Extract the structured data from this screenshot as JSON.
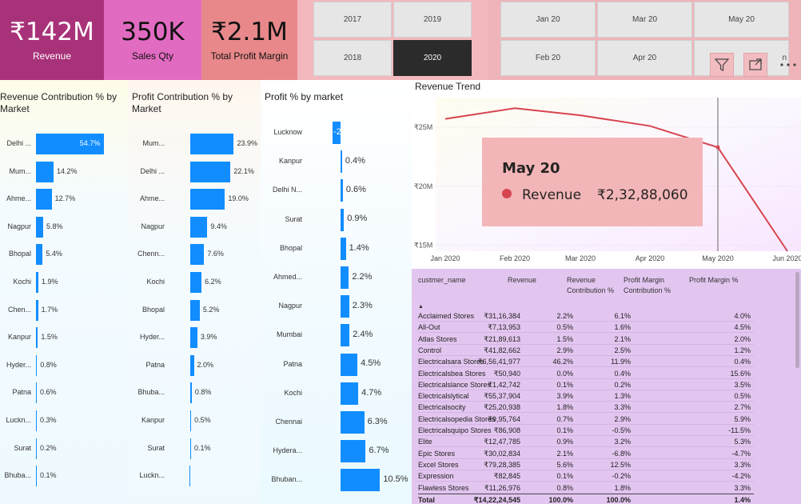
{
  "kpis": {
    "revenue": {
      "value": "₹142M",
      "label": "Revenue"
    },
    "qty": {
      "value": "350K",
      "label": "Sales Qty"
    },
    "profit": {
      "value": "₹2.1M",
      "label": "Total Profit Margin"
    }
  },
  "year_slicer": {
    "options": [
      "2017",
      "2019",
      "2018",
      "2020"
    ],
    "selected": "2020"
  },
  "month_slicer": {
    "options": [
      "Jan 20",
      "Mar 20",
      "May 20",
      "Feb 20",
      "Apr 20"
    ],
    "partial": "n"
  },
  "toolbar": {
    "filter_icon": "filter-icon",
    "focus_icon": "focus-mode-icon",
    "more_icon": "more-options-icon"
  },
  "revenue_contribution": {
    "title": "Revenue Contribution % by Market",
    "chart_data": {
      "type": "bar",
      "categories": [
        "Delhi ...",
        "Mum...",
        "Ahme...",
        "Nagpur",
        "Bhopal",
        "Kochi",
        "Chen...",
        "Kanpur",
        "Hyder...",
        "Patna",
        "Luckn...",
        "Surat",
        "Bhuba..."
      ],
      "values": [
        54.7,
        14.2,
        12.7,
        5.8,
        5.4,
        1.9,
        1.7,
        1.5,
        0.8,
        0.6,
        0.3,
        0.2,
        0.1
      ],
      "labels": [
        "54.7%",
        "14.2%",
        "12.7%",
        "5.8%",
        "5.4%",
        "1.9%",
        "1.7%",
        "1.5%",
        "0.8%",
        "0.6%",
        "0.3%",
        "0.2%",
        "0.1%"
      ]
    }
  },
  "profit_contribution": {
    "title": "Profit Contribution % by Market",
    "chart_data": {
      "type": "bar",
      "categories": [
        "Mum...",
        "Delhi ...",
        "Ahme...",
        "Nagpur",
        "Chenn...",
        "Kochi",
        "Bhopal",
        "Hyder...",
        "Patna",
        "Bhuba...",
        "Kanpur",
        "Surat",
        "Luckn..."
      ],
      "values": [
        23.9,
        22.1,
        19.0,
        9.4,
        7.6,
        6.2,
        5.2,
        3.9,
        2.0,
        0.8,
        0.5,
        0.1,
        -0.3
      ],
      "labels": [
        "23.9%",
        "22.1%",
        "19.0%",
        "9.4%",
        "7.6%",
        "6.2%",
        "5.2%",
        "3.9%",
        "2.0%",
        "0.8%",
        "0.5%",
        "0.1%",
        ""
      ]
    }
  },
  "profit_pct": {
    "title": "Profit % by market",
    "chart_data": {
      "type": "bar",
      "categories": [
        "Lucknow",
        "Kanpur",
        "Delhi N...",
        "Surat",
        "Bhopal",
        "Ahmed...",
        "Nagpur",
        "Mumbai",
        "Patna",
        "Kochi",
        "Chennai",
        "Hydera...",
        "Bhuban..."
      ],
      "values": [
        -2.1,
        0.4,
        0.6,
        0.9,
        1.4,
        2.2,
        2.3,
        2.4,
        4.5,
        4.7,
        6.3,
        6.7,
        10.5
      ],
      "labels": [
        "-2",
        "0.4%",
        "0.6%",
        "0.9%",
        "1.4%",
        "2.2%",
        "2.3%",
        "2.4%",
        "4.5%",
        "4.7%",
        "6.3%",
        "6.7%",
        "10.5%"
      ]
    }
  },
  "revenue_trend": {
    "title": "Revenue Trend",
    "chart_data": {
      "type": "line",
      "x": [
        "Jan 2020",
        "Feb 2020",
        "Mar 2020",
        "Apr 2020",
        "May 2020",
        "Jun 2020"
      ],
      "series": [
        {
          "values": [
            25.7,
            26.6,
            26.0,
            25.1,
            23.29,
            14.5
          ]
        }
      ],
      "yticks": [
        "₹25M",
        "₹20M",
        "₹15M"
      ],
      "ytick_values": [
        25,
        20,
        15
      ],
      "ylim": [
        14.5,
        27.5
      ],
      "grid": true
    },
    "tooltip": {
      "title": "May 20",
      "label": "Revenue",
      "value": "₹2,32,88,060"
    }
  },
  "table": {
    "headers": [
      "custmer_name",
      "Revenue",
      "Revenue Contribution %",
      "Profit Margin Contribution %",
      "Profit Margin %"
    ],
    "sort_indicator": "▲",
    "rows": [
      [
        "Acclaimed Stores",
        "₹31,16,384",
        "2.2%",
        "6.1%",
        "4.0%"
      ],
      [
        "All-Out",
        "₹7,13,953",
        "0.5%",
        "1.6%",
        "4.5%"
      ],
      [
        "Atlas Stores",
        "₹21,89,613",
        "1.5%",
        "2.1%",
        "2.0%"
      ],
      [
        "Control",
        "₹41,82,662",
        "2.9%",
        "2.5%",
        "1.2%"
      ],
      [
        "Electricalsara Stores",
        "₹6,56,41,977",
        "46.2%",
        "11.9%",
        "0.4%"
      ],
      [
        "Electricalsbea Stores",
        "₹50,940",
        "0.0%",
        "0.4%",
        "15.6%"
      ],
      [
        "Electricalslance Stores",
        "₹1,42,742",
        "0.1%",
        "0.2%",
        "3.5%"
      ],
      [
        "Electricalslytical",
        "₹55,37,904",
        "3.9%",
        "1.3%",
        "0.5%"
      ],
      [
        "Electricalsocity",
        "₹25,20,938",
        "1.8%",
        "3.3%",
        "2.7%"
      ],
      [
        "Electricalsopedia Stores",
        "₹9,95,764",
        "0.7%",
        "2.9%",
        "5.9%"
      ],
      [
        "Electricalsquipo Stores",
        "₹86,908",
        "0.1%",
        "-0.5%",
        "-11.5%"
      ],
      [
        "Elite",
        "₹12,47,785",
        "0.9%",
        "3.2%",
        "5.3%"
      ],
      [
        "Epic Stores",
        "₹30,02,834",
        "2.1%",
        "-6.8%",
        "-4.7%"
      ],
      [
        "Excel Stores",
        "₹79,28,385",
        "5.6%",
        "12.5%",
        "3.3%"
      ],
      [
        "Expression",
        "₹82,845",
        "0.1%",
        "-0.2%",
        "-4.2%"
      ],
      [
        "Flawless Stores",
        "₹11,26,976",
        "0.8%",
        "1.8%",
        "3.3%"
      ]
    ],
    "total": [
      "Total",
      "₹14,22,24,545",
      "100.0%",
      "100.0%",
      "1.4%"
    ]
  }
}
